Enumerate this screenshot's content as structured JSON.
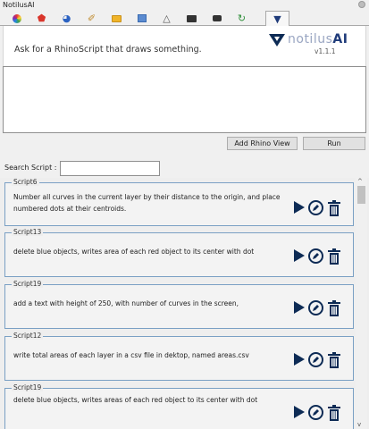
{
  "window": {
    "title": "NotilusAI"
  },
  "tabs": [
    {
      "icon": "color-wheel-icon",
      "glyph": "●",
      "color": "#d94f3d"
    },
    {
      "icon": "shield-icon",
      "glyph": "⬟",
      "color": "#d9352b"
    },
    {
      "icon": "globe-icon",
      "glyph": "◕",
      "color": "#2b62c2"
    },
    {
      "icon": "pencil-icon",
      "glyph": "✐",
      "color": "#c08b2e"
    },
    {
      "icon": "folder-icon",
      "glyph": "▭",
      "color": "#e0a521"
    },
    {
      "icon": "image-icon",
      "glyph": "▣",
      "color": "#4b7bbf"
    },
    {
      "icon": "bell-icon",
      "glyph": "△",
      "color": "#555555"
    },
    {
      "icon": "monitor-icon",
      "glyph": "▬",
      "color": "#333333"
    },
    {
      "icon": "camera-icon",
      "glyph": "◙",
      "color": "#333333"
    },
    {
      "icon": "refresh-icon",
      "glyph": "↻",
      "color": "#2f8f3a"
    },
    {
      "icon": "notilus-logo-icon",
      "glyph": "▼",
      "color": "#1f3b7a"
    }
  ],
  "header": {
    "prompt_text": "Ask for a RhinoScript that draws something.",
    "logo_left": "notilus",
    "logo_right": "AI",
    "version": "v1.1.1"
  },
  "prompt_input": {
    "value": ""
  },
  "buttons": {
    "add_rhino_view": "Add Rhino View",
    "run": "Run"
  },
  "search": {
    "label": "Search Script :",
    "value": ""
  },
  "scripts": [
    {
      "name": "Script6",
      "description": "Number all curves in the current layer by their distance to the origin, and place numbered dots at their centroids."
    },
    {
      "name": "Script13",
      "description": "delete blue objects, writes area of each red object to its center with dot"
    },
    {
      "name": "Script19",
      "description": "add a text with height of 250, with number of curves in the screen,"
    },
    {
      "name": "Script12",
      "description": "write total areas of each layer in a csv file in dektop, named areas.csv"
    },
    {
      "name": "Script19",
      "description": "delete blue objects, writes areas of each red object to its center with dot"
    }
  ],
  "colors": {
    "accent": "#0d2b55",
    "card_border": "#7aa0c4"
  }
}
